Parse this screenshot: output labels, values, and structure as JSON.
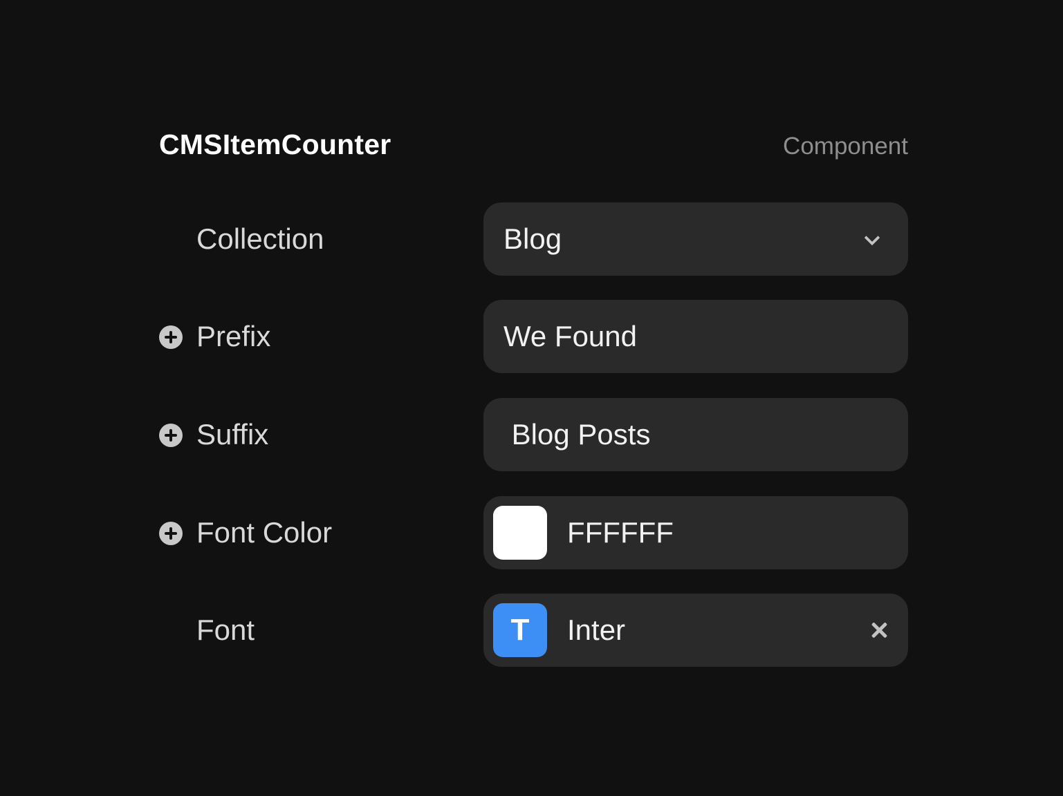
{
  "header": {
    "title": "CMSItemCounter",
    "kind": "Component"
  },
  "rows": [
    {
      "label": "Collection",
      "has_plus_icon": false,
      "control": "select",
      "value": "Blog"
    },
    {
      "label": "Prefix",
      "has_plus_icon": true,
      "control": "text",
      "value": "We Found"
    },
    {
      "label": "Suffix",
      "has_plus_icon": true,
      "control": "text",
      "value": " Blog Posts"
    },
    {
      "label": "Font Color",
      "has_plus_icon": true,
      "control": "color",
      "value": "FFFFFF",
      "swatch_color": "#FFFFFF"
    },
    {
      "label": "Font",
      "has_plus_icon": false,
      "control": "font",
      "value": "Inter",
      "badge_glyph": "T",
      "badge_color": "#3D8FF5"
    }
  ],
  "icons": {
    "plus": "plus-circle-icon",
    "chevron": "chevron-down-icon",
    "clear": "close-icon",
    "font": "text-icon"
  }
}
